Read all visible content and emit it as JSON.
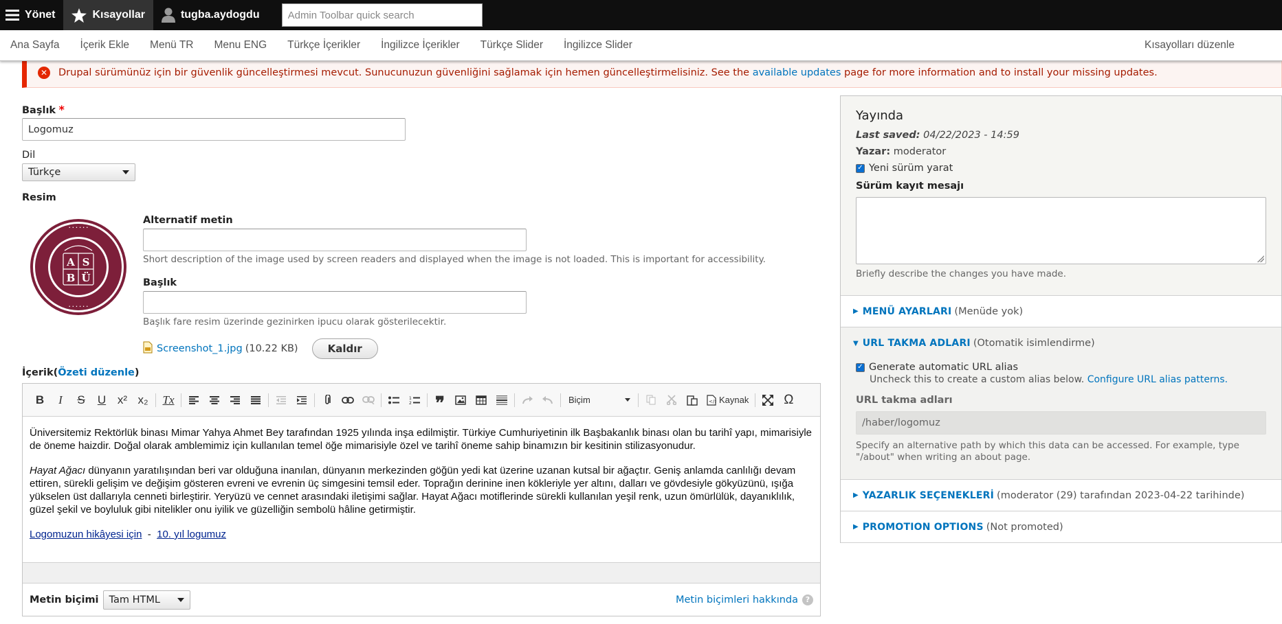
{
  "toolbar": {
    "manage_label": "Yönet",
    "shortcuts_label": "Kısayollar",
    "user_label": "tugba.aydogdu",
    "search_placeholder": "Admin Toolbar quick search"
  },
  "shortcuts_tray": {
    "items": [
      "Ana Sayfa",
      "İçerik Ekle",
      "Menü TR",
      "Menu ENG",
      "Türkçe İçerikler",
      "İngilizce İçerikler",
      "Türkçe Slider",
      "İngilizce Slider"
    ],
    "edit_label": "Kısayolları düzenle"
  },
  "message": {
    "text_before": "Drupal sürümünüz için bir güvenlik güncelleştirmesi mevcut. Sunucunuzun güvenliğini sağlamak için hemen güncelleştirmelisiniz. See the ",
    "link": "available updates",
    "text_after": " page for more information and to install your missing updates."
  },
  "form": {
    "title_label": "Başlık",
    "required_mark": "*",
    "title_value": "Logomuz",
    "language_label": "Dil",
    "language_value": "Türkçe",
    "image_label": "Resim",
    "alt_label": "Alternatif metin",
    "alt_value": "",
    "alt_help": "Short description of the image used by screen readers and displayed when the image is not loaded. This is important for accessibility.",
    "img_title_label": "Başlık",
    "img_title_value": "",
    "img_title_help": "Başlık fare resim üzerinde gezinirken ipucu olarak gösterilecektir.",
    "file_name": "Screenshot_1.jpg",
    "file_size": "(10.22 KB)",
    "remove_button": "Kaldır",
    "body_label": "İçerik",
    "summary_link": "Özeti düzenle",
    "format_label": "Metin biçimi",
    "format_value": "Tam HTML",
    "format_help_link": "Metin biçimleri hakkında"
  },
  "editor": {
    "format_combo": "Biçim",
    "source_label": "Kaynak",
    "paragraph1": "Üniversitemiz Rektörlük binası Mimar Yahya Ahmet Bey tarafından 1925 yılında inşa edilmiştir. Türkiye Cumhuriyetinin ilk Başbakanlık binası olan bu tarihî yapı, mimarisiyle de öneme haizdir. Doğal olarak amblemimiz için kullanılan temel öğe mimarisiyle özel ve tarihî öneme sahip binamızın bir kesitinin stilizasyonudur.",
    "paragraph2_italic": "Hayat Ağacı",
    "paragraph2_rest": " dünyanın yaratılışından beri var olduğuna inanılan, dünyanın merkezinden göğün yedi kat üzerine uzanan kutsal bir ağaçtır. Geniş anlamda canlılığı devam ettiren, sürekli gelişim ve değişim gösteren evreni ve evrenin üç simgesini temsil eder. Toprağın derinine inen kökleriyle yer altını, dalları ve gövdesiyle gökyüzünü, ışığa yükselen üst dallarıyla cenneti birleştirir. Yeryüzü ve cennet arasındaki iletişimi sağlar. Hayat Ağacı motiflerinde sürekli kullanılan yeşil renk, uzun ömürlülük, dayanıklılık, güzel şekil ve boyluluk gibi nitelikler onu iyilik ve güzelliğin sembolü hâline getirmiştir.",
    "link1": "Logomuzun hikâyesi için",
    "separator": "-",
    "link2": "10. yıl logumuz"
  },
  "sidebar": {
    "status_title": "Yayında",
    "last_saved_label": "Last saved:",
    "last_saved_value": "04/22/2023 - 14:59",
    "author_label": "Yazar:",
    "author_value": "moderator",
    "new_revision_label": "Yeni sürüm yarat",
    "revision_log_label": "Sürüm kayıt mesajı",
    "revision_log_help": "Briefly describe the changes you have made.",
    "menu_title": "MENÜ AYARLARI",
    "menu_summary": "(Menüde yok)",
    "url_title": "URL TAKMA ADLARI",
    "url_summary": "(Otomatik isimlendirme)",
    "auto_alias_label": "Generate automatic URL alias",
    "auto_alias_desc": "Uncheck this to create a custom alias below. ",
    "auto_alias_link": "Configure URL alias patterns.",
    "alias_label": "URL takma adları",
    "alias_value": "/haber/logomuz",
    "alias_help": "Specify an alternative path by which this data can be accessed. For example, type \"/about\" when writing an about page.",
    "authoring_title": "YAZARLIK SEÇENEKLERİ",
    "authoring_summary": "(moderator (29) tarafından 2023-04-22 tarihinde)",
    "promotion_title": "PROMOTION OPTIONS",
    "promotion_summary": "(Not promoted)"
  },
  "colors": {
    "toolbar_bg": "#0f0f0f",
    "link": "#0074bd",
    "error": "#e62600",
    "logo_maroon": "#7d1f3a"
  }
}
